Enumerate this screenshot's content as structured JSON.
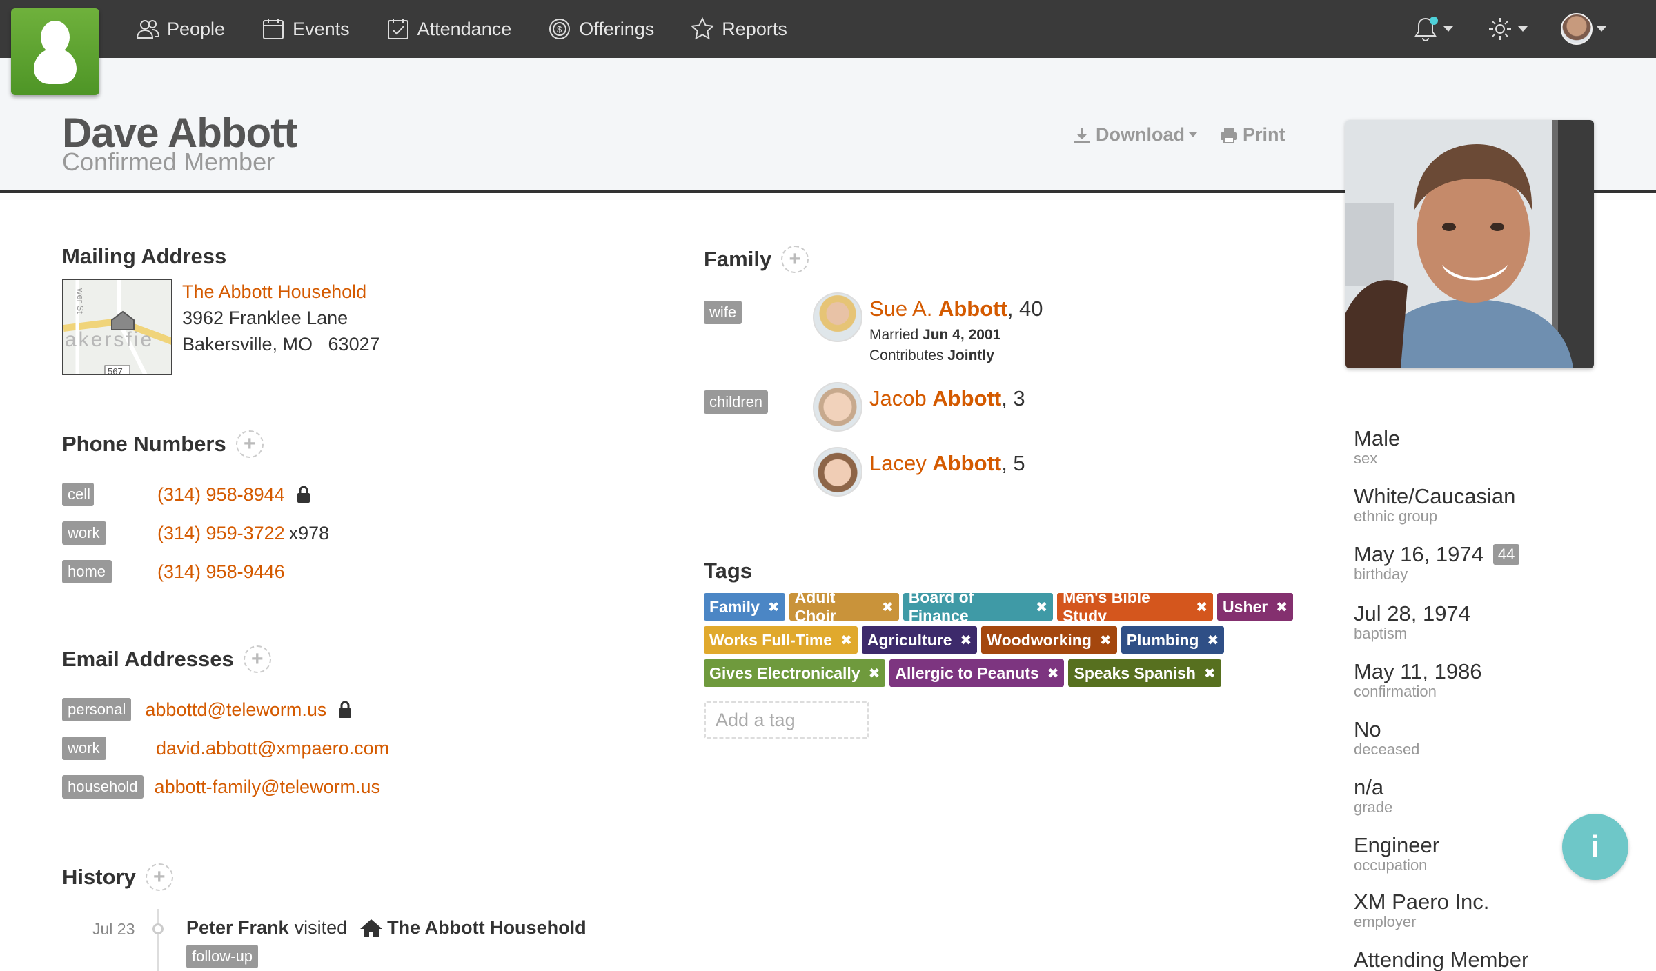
{
  "nav": {
    "items": [
      {
        "label": "People",
        "icon": "people-icon"
      },
      {
        "label": "Events",
        "icon": "calendar-icon"
      },
      {
        "label": "Attendance",
        "icon": "checkbox-icon"
      },
      {
        "label": "Offerings",
        "icon": "coin-icon"
      },
      {
        "label": "Reports",
        "icon": "star-icon"
      }
    ]
  },
  "header": {
    "name": "Dave Abbott",
    "status": "Confirmed Member",
    "download_label": "Download",
    "print_label": "Print"
  },
  "mailing": {
    "title": "Mailing Address",
    "household": "The Abbott Household",
    "street": "3962 Franklee Lane",
    "city_line": "Bakersville, MO   63027",
    "map_text": "akersfie",
    "map_road": "wer St",
    "map_route": "567"
  },
  "phones": {
    "title": "Phone Numbers",
    "items": [
      {
        "type": "cell",
        "number": "(314) 958-8944",
        "ext": ""
      },
      {
        "type": "work",
        "number": "(314) 959-3722",
        "ext": "x978"
      },
      {
        "type": "home",
        "number": "(314) 958-9446",
        "ext": ""
      }
    ]
  },
  "emails": {
    "title": "Email Addresses",
    "items": [
      {
        "type": "personal",
        "address": "abbottd@teleworm.us"
      },
      {
        "type": "work",
        "address": "david.abbott@xmpaero.com"
      },
      {
        "type": "household",
        "address": "abbott-family@teleworm.us"
      }
    ]
  },
  "history": {
    "title": "History",
    "date": "Jul 23",
    "actor": "Peter Frank",
    "verb": "visited",
    "target": "The Abbott Household",
    "badge": "follow-up"
  },
  "family": {
    "title": "Family",
    "wife_label": "wife",
    "children_label": "children",
    "wife": {
      "first": "Sue A.",
      "last": "Abbott",
      "age": ", 40",
      "married_label": "Married",
      "married_date": "Jun 4, 2001",
      "contrib_label": "Contributes",
      "contrib_value": "Jointly"
    },
    "children": [
      {
        "first": "Jacob",
        "last": "Abbott",
        "age": ", 3"
      },
      {
        "first": "Lacey",
        "last": "Abbott",
        "age": ", 5"
      }
    ]
  },
  "tags": {
    "title": "Tags",
    "add_placeholder": "Add a tag",
    "rows": [
      [
        {
          "label": "Family",
          "color": "#4b86c5"
        },
        {
          "label": "Adult Choir",
          "color": "#c9933a"
        },
        {
          "label": "Board of Finance",
          "color": "#3f9aa6"
        },
        {
          "label": "Men's Bible Study",
          "color": "#d4561d"
        },
        {
          "label": "Usher",
          "color": "#84306f"
        }
      ],
      [
        {
          "label": "Works Full-Time",
          "color": "#e0a92d"
        },
        {
          "label": "Agriculture",
          "color": "#3d2a6b"
        },
        {
          "label": "Woodworking",
          "color": "#a4470e"
        },
        {
          "label": "Plumbing",
          "color": "#2f4f86"
        }
      ],
      [
        {
          "label": "Gives Electronically",
          "color": "#6f9a3d"
        },
        {
          "label": "Allergic to Peanuts",
          "color": "#7d3580"
        },
        {
          "label": "Speaks Spanish",
          "color": "#57701f"
        }
      ]
    ]
  },
  "details": [
    {
      "value": "Male",
      "key": "sex"
    },
    {
      "value": "White/Caucasian",
      "key": "ethnic group"
    },
    {
      "value": "May 16, 1974",
      "key": "birthday",
      "badge": "44"
    },
    {
      "value": "Jul 28, 1974",
      "key": "baptism"
    },
    {
      "value": "May 11, 1986",
      "key": "confirmation"
    },
    {
      "value": "No",
      "key": "deceased"
    },
    {
      "value": "n/a",
      "key": "grade"
    },
    {
      "value": "Engineer",
      "key": "occupation"
    },
    {
      "value": "XM Paero Inc.",
      "key": "employer"
    },
    {
      "value": "Attending Member",
      "key": ""
    }
  ],
  "info_button": "i",
  "colors": {
    "link": "#d45a00",
    "topbar": "#3a3a3a",
    "logo": "#5ea231"
  }
}
